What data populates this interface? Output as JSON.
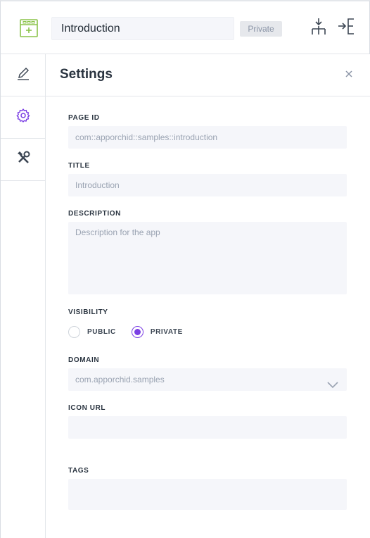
{
  "header": {
    "page_title": "Introduction",
    "visibility_badge": "Private",
    "app_icon": "app-window-icon",
    "colors": {
      "app_icon": "#8bc34a"
    }
  },
  "rail": {
    "items": [
      {
        "icon": "pen-icon"
      },
      {
        "icon": "gear-icon",
        "active": true
      },
      {
        "icon": "tools-icon"
      }
    ]
  },
  "settings": {
    "title": "Settings",
    "page_id": {
      "label": "PAGE ID",
      "value": "com::apporchid::samples::introduction"
    },
    "title_field": {
      "label": "TITLE",
      "value": "Introduction"
    },
    "description": {
      "label": "DESCRIPTION",
      "placeholder": "Description for the app"
    },
    "visibility": {
      "label": "VISIBILITY",
      "options": [
        "PUBLIC",
        "PRIVATE"
      ],
      "selected": "PRIVATE"
    },
    "domain": {
      "label": "DOMAIN",
      "value": "com.apporchid.samples"
    },
    "icon_url": {
      "label": "ICON URL",
      "value": ""
    },
    "tags": {
      "label": "TAGS",
      "value": ""
    }
  },
  "colors": {
    "accent": "#7b3fe4"
  }
}
